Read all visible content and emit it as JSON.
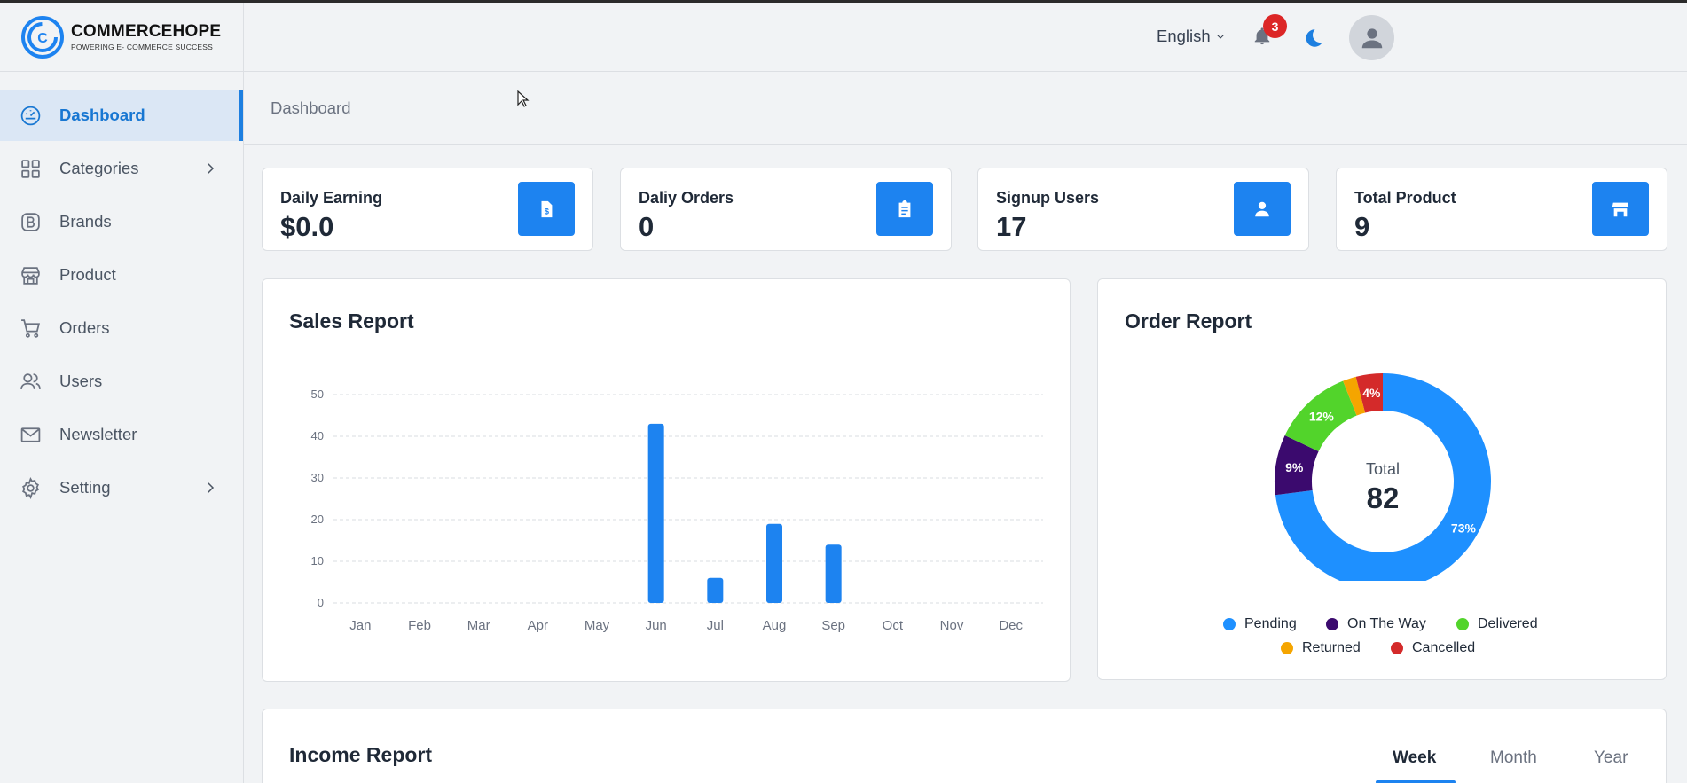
{
  "brand": {
    "title": "COMMERCEHOPE",
    "subtitle": "POWERING E- COMMERCE SUCCESS"
  },
  "sidebar": {
    "items": [
      {
        "label": "Dashboard",
        "icon": "gauge-icon",
        "active": true
      },
      {
        "label": "Categories",
        "icon": "grid-icon",
        "has_children": true
      },
      {
        "label": "Brands",
        "icon": "brand-icon"
      },
      {
        "label": "Product",
        "icon": "store-icon"
      },
      {
        "label": "Orders",
        "icon": "cart-icon"
      },
      {
        "label": "Users",
        "icon": "users-icon"
      },
      {
        "label": "Newsletter",
        "icon": "mail-icon"
      },
      {
        "label": "Setting",
        "icon": "gear-icon",
        "has_children": true
      }
    ]
  },
  "topbar": {
    "language": "English",
    "notification_count": "3"
  },
  "breadcrumb": "Dashboard",
  "cards": [
    {
      "title": "Daily Earning",
      "value": "$0.0",
      "icon": "dollar-file-icon"
    },
    {
      "title": "Daliy Orders",
      "value": "0",
      "icon": "clipboard-icon"
    },
    {
      "title": "Signup Users",
      "value": "17",
      "icon": "user-icon"
    },
    {
      "title": "Total Product",
      "value": "9",
      "icon": "store-icon"
    }
  ],
  "sales_report": {
    "title": "Sales Report"
  },
  "order_report": {
    "title": "Order Report",
    "center_label": "Total",
    "center_value": "82"
  },
  "income_report": {
    "title": "Income Report",
    "tabs": [
      "Week",
      "Month",
      "Year"
    ],
    "active_tab": "Week"
  },
  "colors": {
    "accent": "#1d83f0",
    "pending": "#1e90ff",
    "on_the_way": "#3b0a6e",
    "delivered": "#52d42b",
    "returned": "#f5a500",
    "cancelled": "#d42a2a"
  },
  "chart_data": [
    {
      "type": "bar",
      "title": "Sales Report",
      "categories": [
        "Jan",
        "Feb",
        "Mar",
        "Apr",
        "May",
        "Jun",
        "Jul",
        "Aug",
        "Sep",
        "Oct",
        "Nov",
        "Dec"
      ],
      "values": [
        0,
        0,
        0,
        0,
        0,
        43,
        6,
        19,
        14,
        0,
        0,
        0
      ],
      "yticks": [
        0,
        10,
        20,
        30,
        40,
        50
      ],
      "ylim": [
        0,
        50
      ],
      "grid": true
    },
    {
      "type": "pie",
      "title": "Order Report",
      "labels": [
        "Pending",
        "On The Way",
        "Delivered",
        "Returned",
        "Cancelled"
      ],
      "values": [
        73,
        9,
        12,
        2,
        4
      ],
      "data_labels": [
        "73%",
        "9%",
        "12%",
        "",
        "4%"
      ],
      "legend": "bottom"
    }
  ]
}
